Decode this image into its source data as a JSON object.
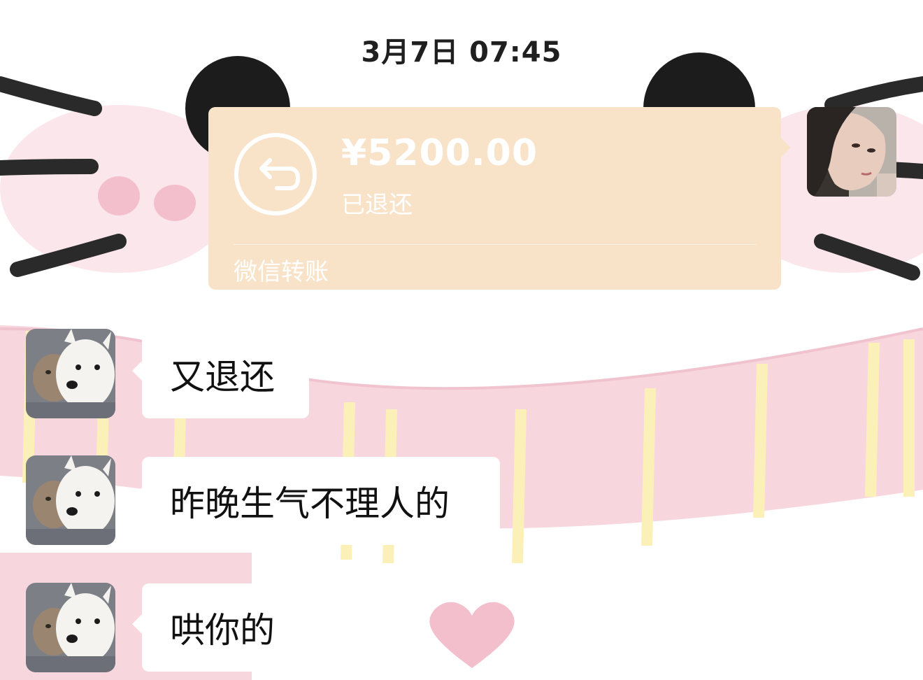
{
  "chat": {
    "timestamp": "3月7日 07:45",
    "transfer": {
      "amount": "¥5200.00",
      "status": "已退还",
      "footer": "微信转账",
      "icon": "return-arrow-icon",
      "card_color": "#f8e3c9"
    },
    "messages": [
      {
        "text": "又退还"
      },
      {
        "text": "昨晚生气不理人的"
      },
      {
        "text": "哄你的"
      }
    ]
  },
  "theme": {
    "background_accent_pink": "#f6c9d4",
    "background_accent_yellow": "#fbf1b8"
  }
}
